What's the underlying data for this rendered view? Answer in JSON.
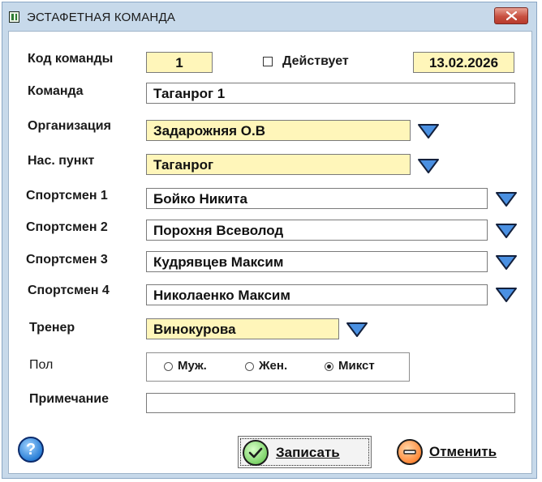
{
  "window": {
    "title": "ЭСТАФЕТНАЯ КОМАНДА"
  },
  "form": {
    "team_code": {
      "label": "Код команды",
      "value": "1"
    },
    "active": {
      "label": "Действует",
      "checked": false
    },
    "date": {
      "value": "13.02.2026"
    },
    "team": {
      "label": "Команда",
      "value": "Таганрог 1"
    },
    "organization": {
      "label": "Организация",
      "value": "Задарожняя О.В"
    },
    "locality": {
      "label": "Нас. пункт",
      "value": "Таганрог"
    },
    "athlete1": {
      "label": "Спортсмен 1",
      "value": "Бойко Никита"
    },
    "athlete2": {
      "label": "Спортсмен 2",
      "value": "Порохня Всеволод"
    },
    "athlete3": {
      "label": "Спортсмен 3",
      "value": "Кудрявцев Максим"
    },
    "athlete4": {
      "label": "Спортсмен 4",
      "value": "Николаенко Максим"
    },
    "coach": {
      "label": "Тренер",
      "value": "Винокурова"
    },
    "gender": {
      "label": "Пол",
      "options": [
        "Муж.",
        "Жен.",
        "Микст"
      ],
      "selected": "Микст"
    },
    "note": {
      "label": "Примечание",
      "value": ""
    }
  },
  "buttons": {
    "help": "?",
    "save": "Записать",
    "cancel": "Отменить"
  },
  "colors": {
    "highlight_field": "#fff6ba",
    "dropdown_arrow": "#4a90e2",
    "window_frame": "#c7d9ea"
  }
}
